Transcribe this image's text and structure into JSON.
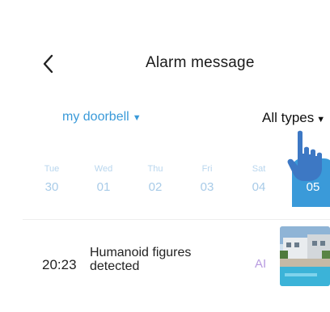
{
  "header": {
    "title": "Alarm message"
  },
  "filters": {
    "device_label": "my doorbell",
    "type_label": "All types"
  },
  "days": [
    {
      "dow": "Tue",
      "num": "30"
    },
    {
      "dow": "Wed",
      "num": "01"
    },
    {
      "dow": "Thu",
      "num": "02"
    },
    {
      "dow": "Fri",
      "num": "03"
    },
    {
      "dow": "Sat",
      "num": "04"
    },
    {
      "dow": "",
      "num": "05",
      "selected": true
    }
  ],
  "alarms": [
    {
      "time": "20:23",
      "description": "Humanoid figures detected",
      "badge": "AI"
    }
  ],
  "colors": {
    "accent": "#3a9ad9",
    "day_inactive": "#a8cbe8",
    "badge": "#b89be0",
    "hand": "#3d78c4"
  },
  "icons": {
    "back": "chevron-left-icon",
    "caret": "caret-down-icon",
    "pointer": "pointing-hand-icon"
  }
}
